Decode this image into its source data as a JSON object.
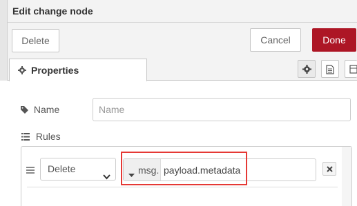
{
  "dialog": {
    "title": "Edit change node"
  },
  "toolbar": {
    "delete_label": "Delete",
    "cancel_label": "Cancel",
    "done_label": "Done"
  },
  "tabs": {
    "properties_label": "Properties",
    "icon_tabs": [
      "gear-icon",
      "document-icon",
      "layout-icon"
    ]
  },
  "form": {
    "name_label": "Name",
    "name_placeholder": "Name",
    "rules_label": "Rules",
    "rule": {
      "action": "Delete",
      "type_prefix": "msg.",
      "property": "payload.metadata"
    }
  },
  "colors": {
    "done_button": "#ad1625",
    "highlight": "#e53935"
  }
}
